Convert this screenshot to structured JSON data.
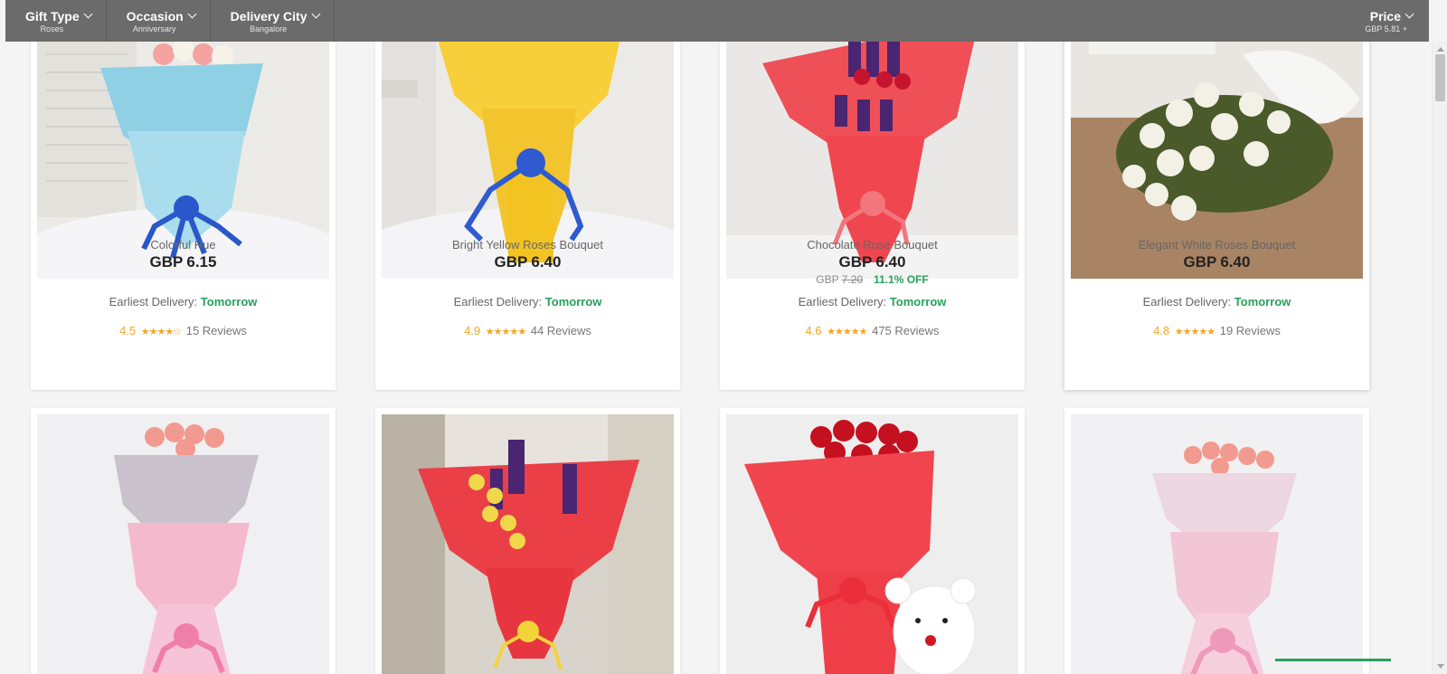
{
  "filters": [
    {
      "title": "Gift Type",
      "sub": "Roses"
    },
    {
      "title": "Occasion",
      "sub": "Anniversary"
    },
    {
      "title": "Delivery City",
      "sub": "Bangalore"
    }
  ],
  "price_filter": {
    "title": "Price",
    "sub": "GBP  5.81 +"
  },
  "delivery_label": "Earliest Delivery:",
  "products": [
    {
      "name": "Colorful Hue",
      "currency": "GBP",
      "price": "6.15",
      "delivery": "Tomorrow",
      "rating": "4.5",
      "stars": "★★★★☆",
      "reviews": "15 Reviews"
    },
    {
      "name": "Bright Yellow Roses Bouquet",
      "currency": "GBP",
      "price": "6.40",
      "delivery": "Tomorrow",
      "rating": "4.9",
      "stars": "★★★★★",
      "reviews": "44 Reviews"
    },
    {
      "name": "Chocolate Rose Bouquet",
      "currency": "GBP",
      "price": "6.40",
      "old_currency": "GBP",
      "old_price": "7.20",
      "discount": "11.1% OFF",
      "delivery": "Tomorrow",
      "rating": "4.6",
      "stars": "★★★★★",
      "reviews": "475 Reviews"
    },
    {
      "name": "Elegant White Roses Bouquet",
      "currency": "GBP",
      "price": "6.40",
      "delivery": "Tomorrow",
      "rating": "4.8",
      "stars": "★★★★★",
      "reviews": "19 Reviews"
    }
  ],
  "colors": {
    "filter_bar": "#6b6b6b",
    "accent_green": "#27a05b",
    "star": "#f5a623"
  }
}
